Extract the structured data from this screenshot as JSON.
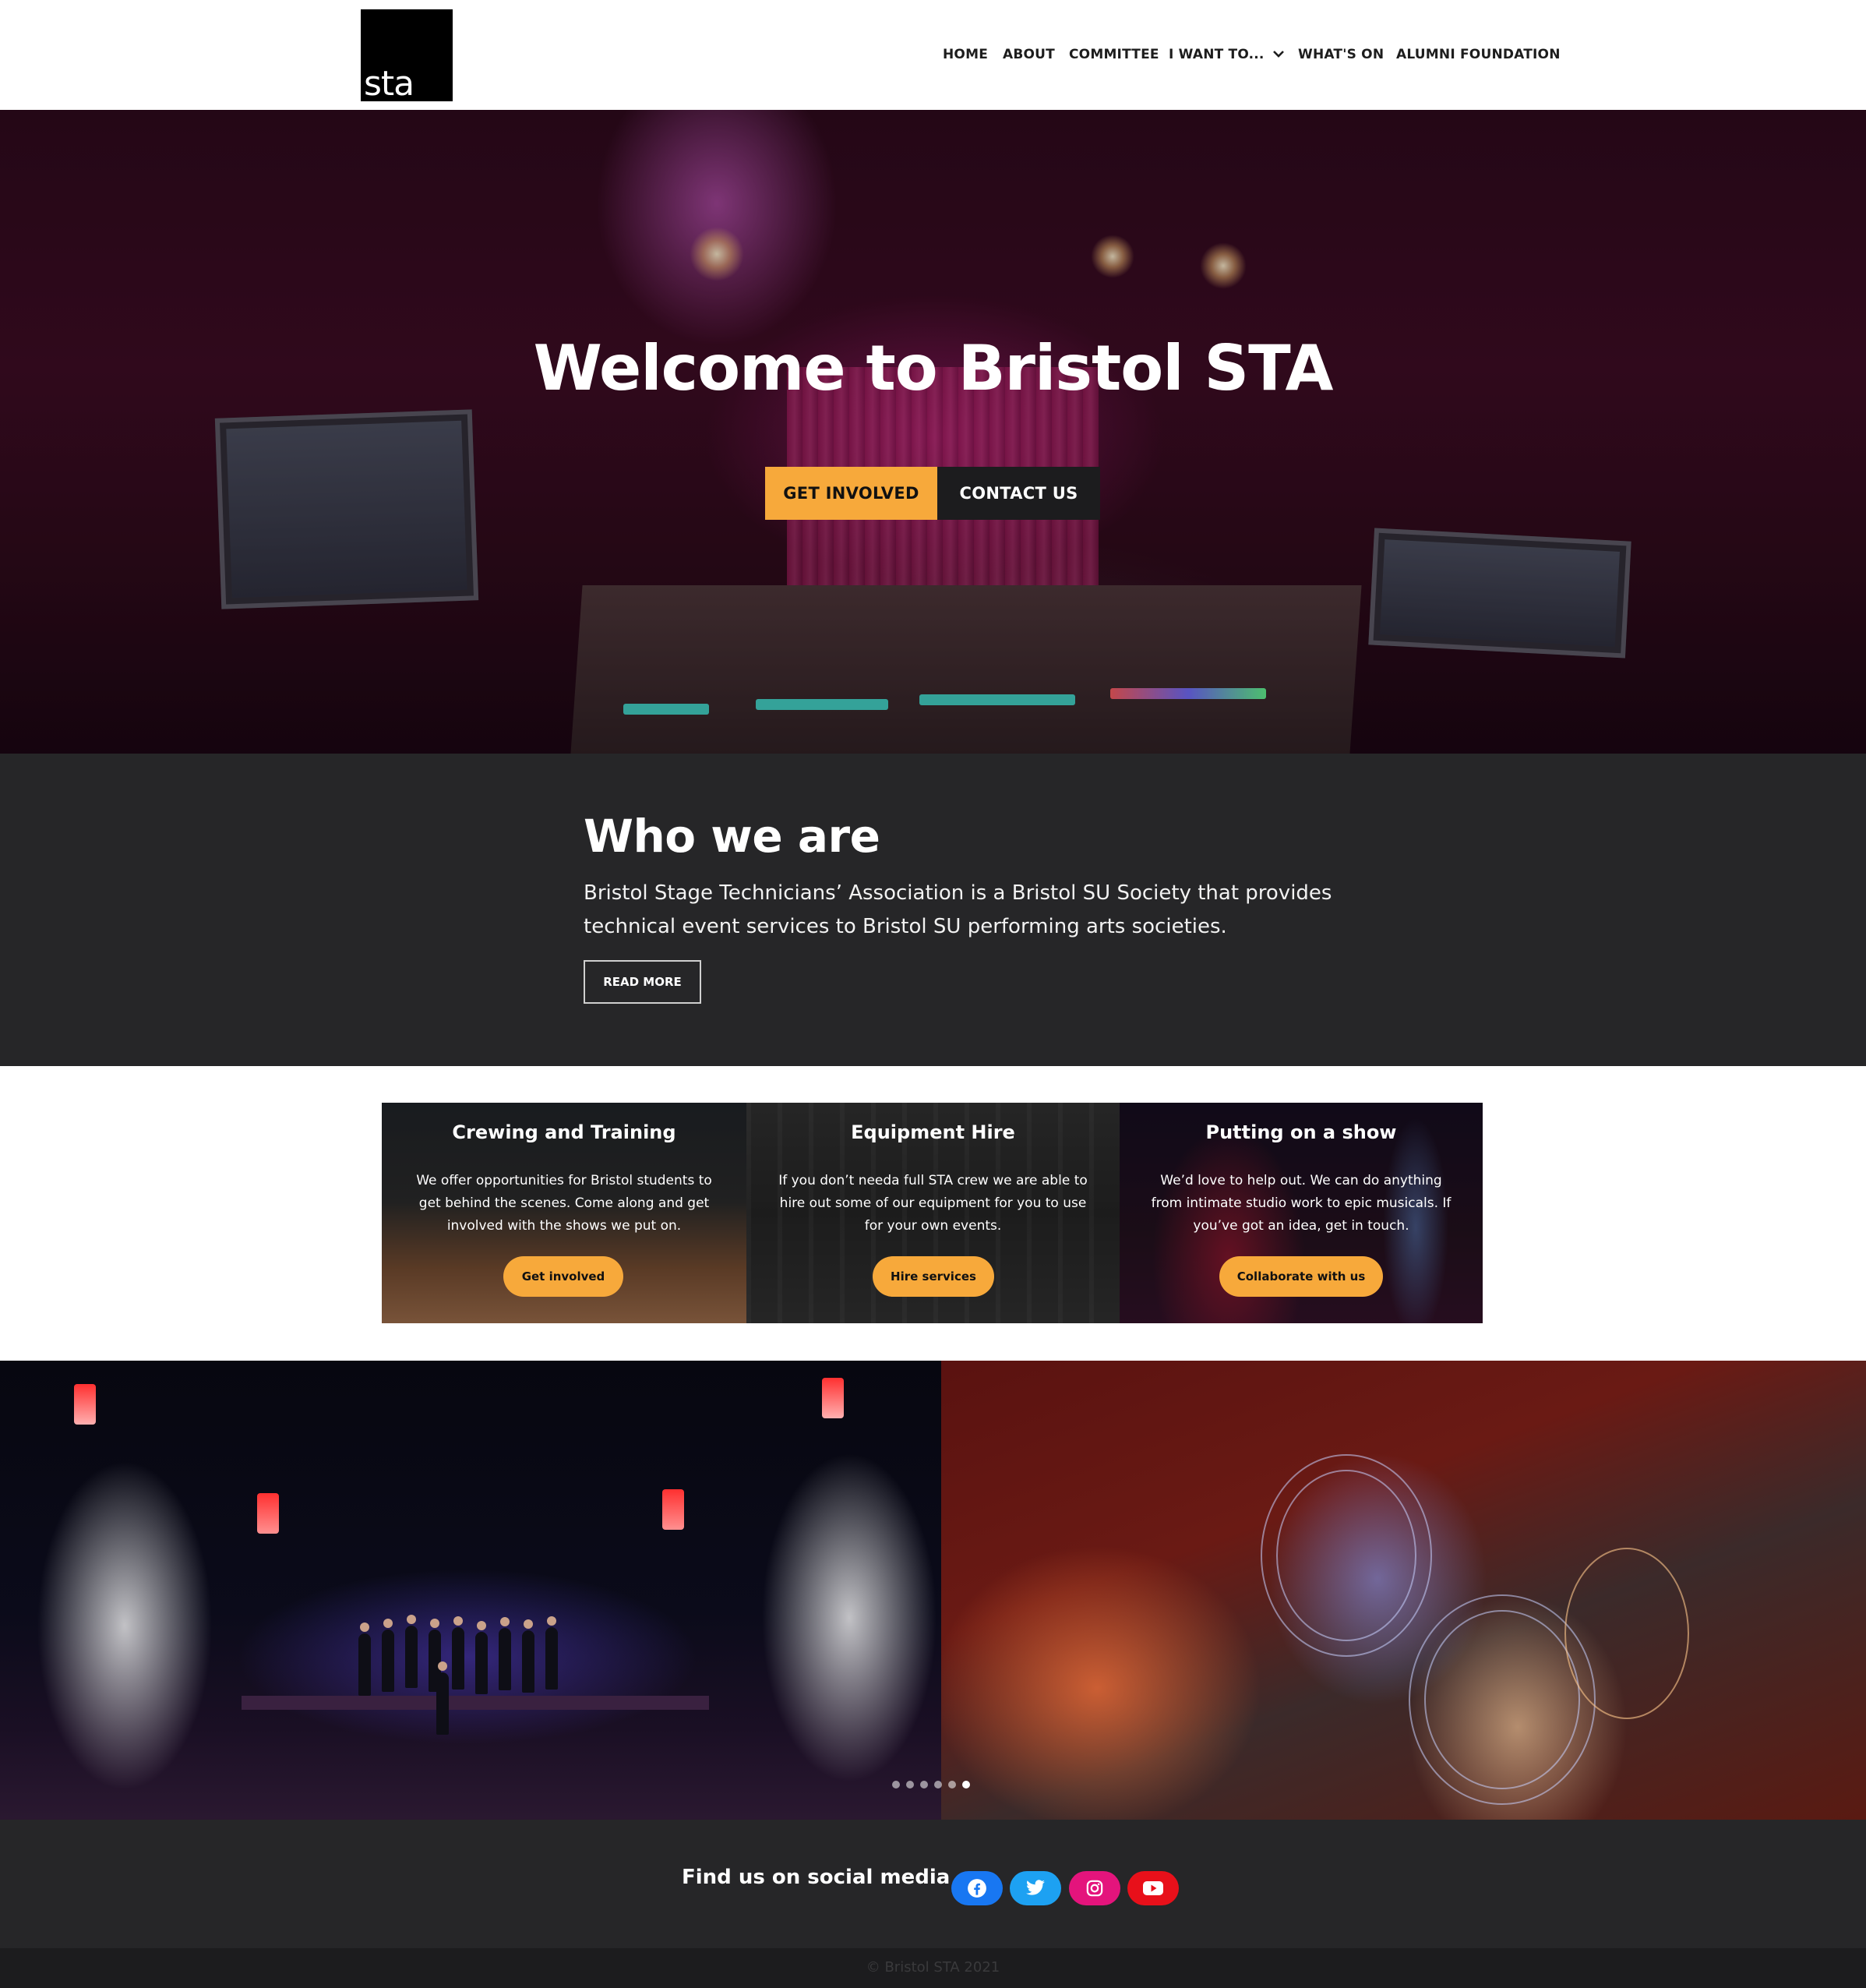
{
  "header": {
    "logo_text": "sta",
    "nav": [
      {
        "label": "HOME"
      },
      {
        "label": "ABOUT"
      },
      {
        "label": "COMMITTEE"
      },
      {
        "label": "I WANT TO..."
      },
      {
        "label": "WHAT'S ON"
      },
      {
        "label": "ALUMNI FOUNDATION"
      }
    ]
  },
  "hero": {
    "title": "Welcome to Bristol STA",
    "get_involved_label": "GET INVOLVED",
    "contact_label": "CONTACT US"
  },
  "who": {
    "title": "Who we are",
    "text": "Bristol Stage Technicians’ Association is a Bristol SU Society that provides technical event services to Bristol SU performing arts societies.",
    "read_more_label": "READ MORE"
  },
  "cards": [
    {
      "title": "Crewing and Training",
      "desc": "We offer opportunities for Bristol students to get behind the scenes. Come along and get involved with the shows we put on.",
      "button": "Get involved"
    },
    {
      "title": "Equipment Hire",
      "desc": "If you don’t needa full STA crew we are able to hire out some of our equipment for you to use for your own events.",
      "button": "Hire services"
    },
    {
      "title": "Putting on a show",
      "desc": "We’d love to help out. We can do anything from intimate studio work to epic musicals. If you’ve got an idea, get in touch.",
      "button": "Collaborate with us"
    }
  ],
  "carousel": {
    "slide_count": 6,
    "active_index": 5
  },
  "social": {
    "title": "Find us on social media",
    "icons": [
      {
        "name": "facebook-icon",
        "color": "#1877f2"
      },
      {
        "name": "twitter-icon",
        "color": "#1da1f2"
      },
      {
        "name": "instagram-icon",
        "color": "#e4147c"
      },
      {
        "name": "youtube-icon",
        "color": "#e8101a"
      }
    ]
  },
  "footer": {
    "copyright": "© Bristol STA 2021"
  },
  "colors": {
    "accent": "#f7a93b",
    "dark": "#262628",
    "footer": "#1c1c1e"
  }
}
